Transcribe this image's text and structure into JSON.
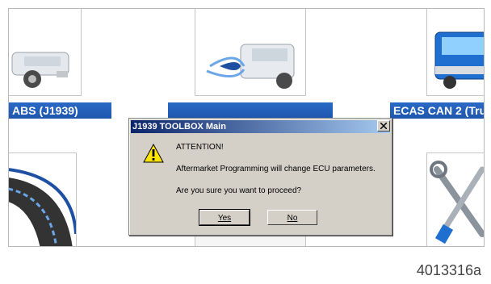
{
  "tiles": {
    "abs_label": "ABS (J1939)",
    "ecas_label": "ECAS CAN 2 (Tru"
  },
  "dialog": {
    "title": "J1939 TOOLBOX Main",
    "heading": "ATTENTION!",
    "message": "Aftermarket Programming will change ECU parameters.",
    "question": "Are you sure you want to proceed?",
    "yes_label": "Yes",
    "no_label": "No",
    "icon": "warning-icon"
  },
  "figure": {
    "reference_code": "4013316a"
  },
  "colors": {
    "tile_label_bg": "#1e56ad",
    "dialog_bg": "#d4d0c8",
    "titlebar_start": "#0a246a",
    "titlebar_end": "#a6caf0"
  }
}
